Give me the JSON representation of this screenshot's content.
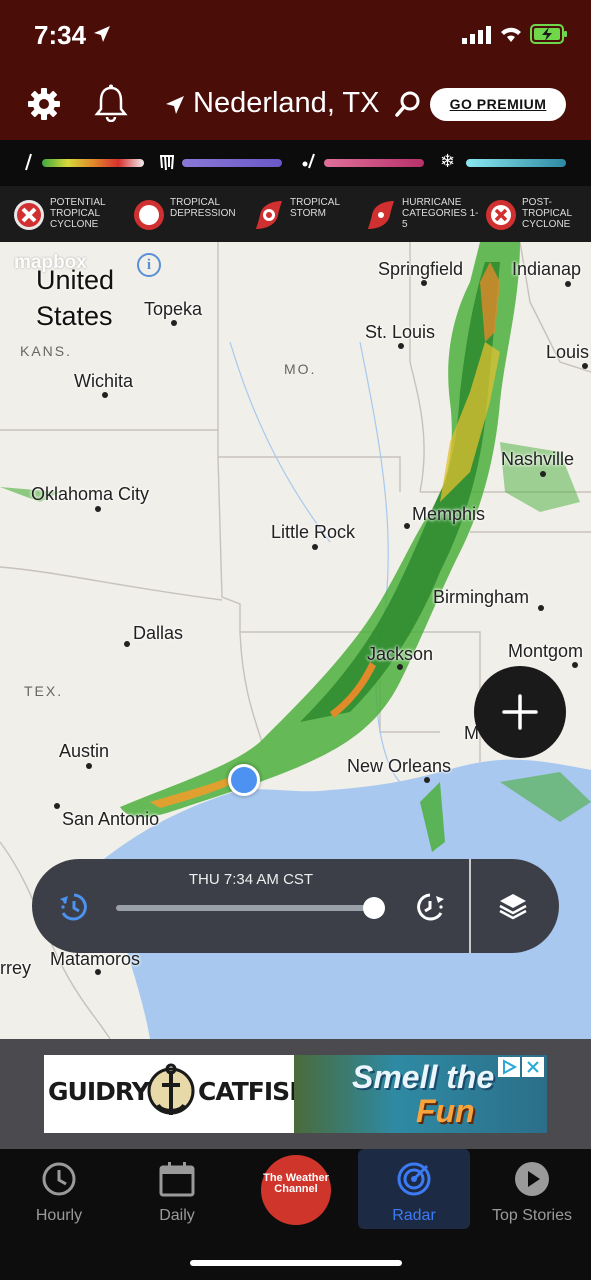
{
  "status": {
    "time": "7:34"
  },
  "header": {
    "location": "Nederland, TX",
    "premium_label": "GO PREMIUM"
  },
  "tropical_legend": [
    {
      "label": "POTENTIAL TROPICAL CYCLONE"
    },
    {
      "label": "TROPICAL DEPRESSION"
    },
    {
      "label": "TROPICAL STORM"
    },
    {
      "label": "HURRICANE CATEGORIES 1-5"
    },
    {
      "label": "POST-TROPICAL CYCLONE"
    }
  ],
  "map": {
    "attribution": "mapbox",
    "country": "United States",
    "cities": [
      "Springfield",
      "Indianap",
      "Topeka",
      "St. Louis",
      "Louis",
      "Wichita",
      "Nashville",
      "Oklahoma City",
      "Memphis",
      "Little Rock",
      "Birmingham",
      "Dallas",
      "Jackson",
      "Montgom",
      "Austin",
      "New Orleans",
      "San Antonio",
      "Matamoros",
      "rrey",
      "M"
    ],
    "states": [
      "KANS.",
      "MO.",
      "TEX."
    ]
  },
  "player": {
    "timestamp": "THU 7:34 AM CST",
    "progress": 0.97
  },
  "ad": {
    "brand_left": "GUIDRY'S",
    "brand_right": "CATFISH",
    "tagline_1": "Smell the",
    "tagline_2": "Fun"
  },
  "tabs": [
    {
      "label": "Hourly"
    },
    {
      "label": "Daily"
    },
    {
      "label": "The Weather Channel"
    },
    {
      "label": "Radar"
    },
    {
      "label": "Top Stories"
    }
  ],
  "colors": {
    "header_bg": "#4a0d08",
    "accent": "#3d7bf5",
    "twc_red": "#d0352b",
    "water": "#a8c8ef"
  }
}
